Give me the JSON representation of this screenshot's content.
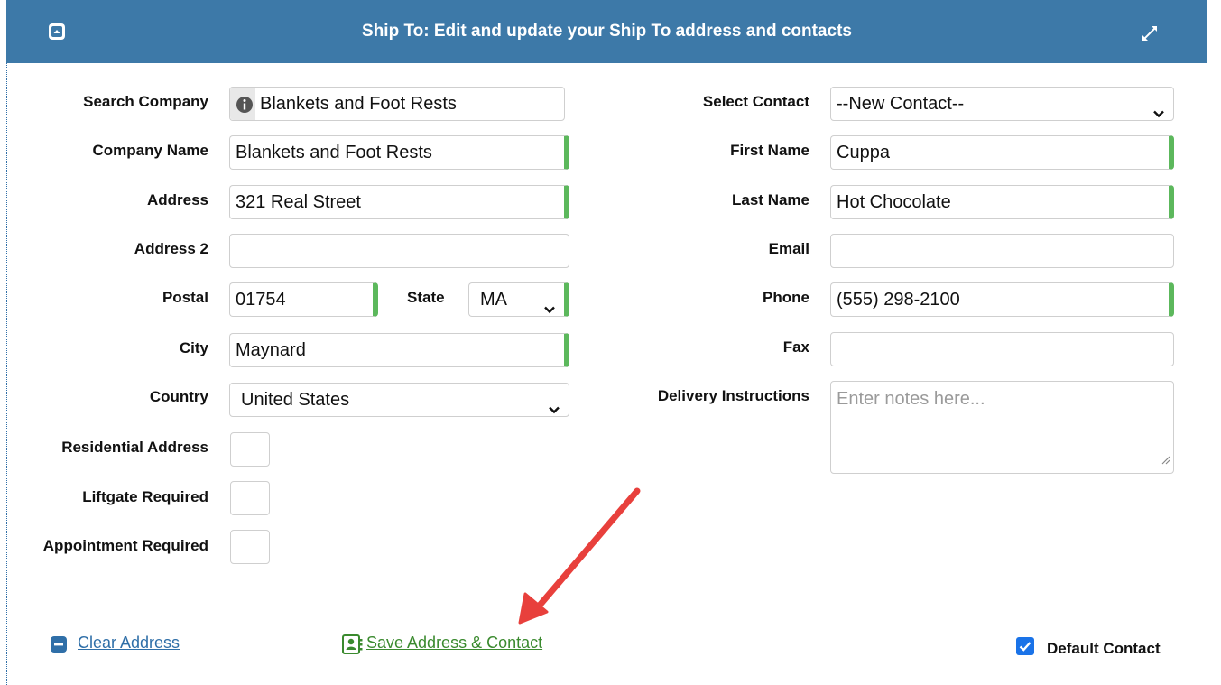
{
  "header": {
    "title": "Ship To: Edit and update your Ship To address and contacts"
  },
  "left": {
    "search_company": {
      "label": "Search Company",
      "value": "Blankets and Foot Rests"
    },
    "company_name": {
      "label": "Company Name",
      "value": "Blankets and Foot Rests"
    },
    "address": {
      "label": "Address",
      "value": "321 Real Street"
    },
    "address2": {
      "label": "Address 2",
      "value": ""
    },
    "postal": {
      "label": "Postal",
      "value": "01754"
    },
    "state": {
      "label": "State",
      "value": "MA"
    },
    "city": {
      "label": "City",
      "value": "Maynard"
    },
    "country": {
      "label": "Country",
      "value": "United States"
    },
    "residential": {
      "label": "Residential Address"
    },
    "liftgate": {
      "label": "Liftgate Required"
    },
    "appointment": {
      "label": "Appointment Required"
    }
  },
  "right": {
    "select_contact": {
      "label": "Select Contact",
      "value": "--New Contact--"
    },
    "first_name": {
      "label": "First Name",
      "value": "Cuppa"
    },
    "last_name": {
      "label": "Last Name",
      "value": "Hot Chocolate"
    },
    "email": {
      "label": "Email",
      "value": ""
    },
    "phone": {
      "label": "Phone",
      "value": "(555) 298-2100"
    },
    "fax": {
      "label": "Fax",
      "value": ""
    },
    "delivery": {
      "label": "Delivery Instructions",
      "placeholder": "Enter notes here..."
    }
  },
  "footer": {
    "clear_address": "Clear Address",
    "save_address": "Save Address & Contact",
    "default_contact": "Default Contact",
    "default_contact_checked": true
  },
  "colors": {
    "header_bg": "#3d79a8",
    "required_bar": "#5cb85c",
    "link_blue": "#2f6fa8",
    "link_green": "#3a8a2e",
    "annotation_arrow": "#e8403c"
  },
  "icons": {
    "collapse": "collapse-icon",
    "expand": "expand-icon",
    "info": "info-icon",
    "dropdown": "chevron-down-icon",
    "clear": "minus-square-icon",
    "save": "contact-card-icon",
    "checkbox": "checkbox-checked-icon"
  }
}
